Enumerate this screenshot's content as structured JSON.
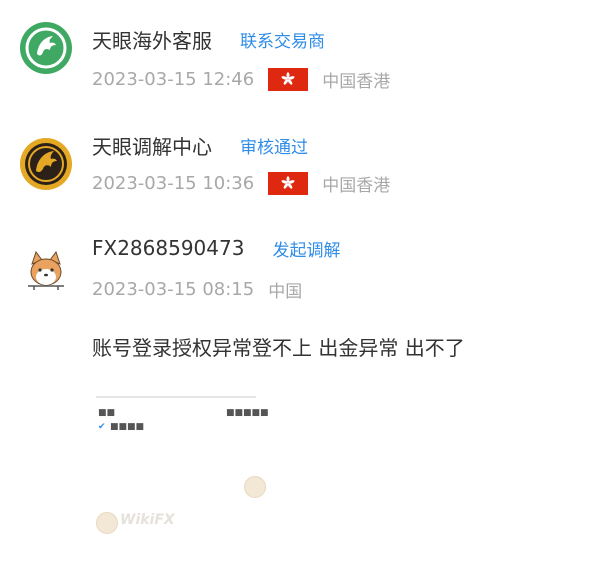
{
  "entries": [
    {
      "name": "天眼海外客服",
      "action": "联系交易商",
      "time": "2023-03-15 12:46",
      "region": "中国香港",
      "avatar_icon": "eagle-icon",
      "avatar_color": "#3fa964",
      "flag_icon": "hong-kong-flag-icon"
    },
    {
      "name": "天眼调解中心",
      "action": "审核通过",
      "time": "2023-03-15 10:36",
      "region": "中国香港",
      "avatar_icon": "eagle-icon",
      "avatar_color": "#e4a825",
      "flag_icon": "hong-kong-flag-icon"
    },
    {
      "name": "FX2868590473",
      "action": "发起调解",
      "time": "2023-03-15 08:15",
      "region": "中国",
      "avatar_icon": "shiba-dog-icon"
    }
  ],
  "comment": "账号登录授权异常登不上 出金异常 出不了",
  "attachment": {
    "watermark_text": "WikiFX",
    "icon": "attachment-image-icon"
  },
  "colors": {
    "link": "#2f8de8",
    "meta": "#a8a8a8",
    "text": "#333333",
    "flag_red": "#de2910"
  }
}
